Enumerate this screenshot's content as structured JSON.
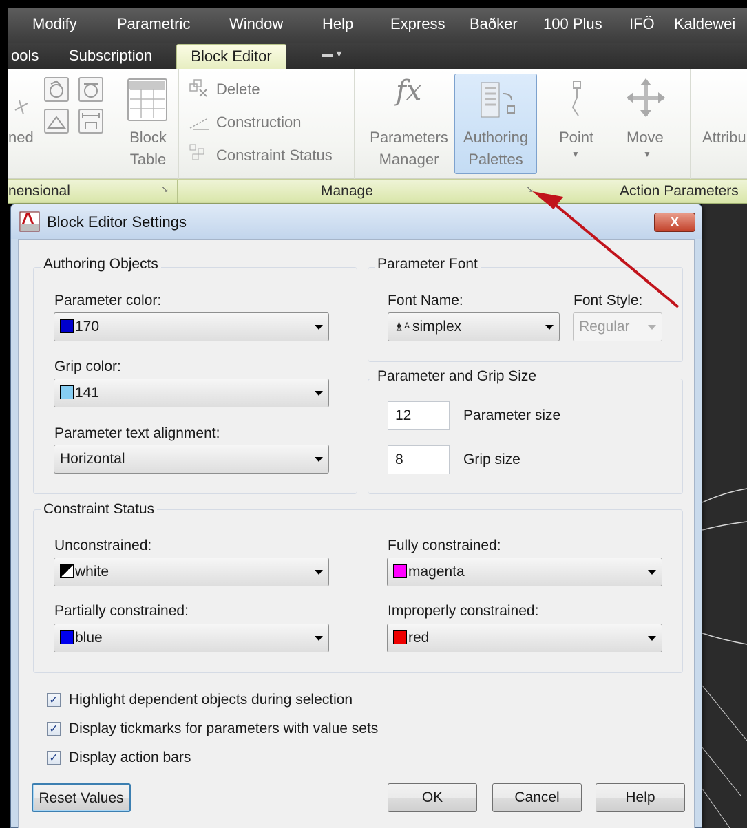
{
  "menubar": {
    "items": [
      "Modify",
      "Parametric",
      "Window",
      "Help",
      "Express",
      "Baðker",
      "100 Plus",
      "IFÖ",
      "Kaldewei"
    ]
  },
  "tabs": {
    "items": [
      "ools",
      "Subscription"
    ],
    "active": "Block Editor"
  },
  "ribbon": {
    "left_partial": "ned",
    "block_table": [
      "Block",
      "Table"
    ],
    "delete": "Delete",
    "construction": "Construction",
    "constraint_status": "Constraint Status",
    "parameters_manager": [
      "Parameters",
      "Manager"
    ],
    "authoring_palettes": [
      "Authoring",
      "Palettes"
    ],
    "point": "Point",
    "move": "Move",
    "attribute_partial": "Attribu",
    "panels": {
      "dimensional": "nensional",
      "manage": "Manage",
      "action_parameters": "Action Parameters"
    }
  },
  "dialog": {
    "title": "Block Editor Settings",
    "close_label": "X",
    "authoring": {
      "title": "Authoring Objects",
      "parameter_color_label": "Parameter color:",
      "parameter_color_value": "170",
      "parameter_color_swatch": "#0000cc",
      "grip_color_label": "Grip color:",
      "grip_color_value": "141",
      "grip_color_swatch": "#86cdf2",
      "text_alignment_label": "Parameter text alignment:",
      "text_alignment_value": "Horizontal"
    },
    "font": {
      "title": "Parameter Font",
      "font_name_label": "Font Name:",
      "font_name_value": "simplex",
      "font_style_label": "Font Style:",
      "font_style_value": "Regular"
    },
    "sizes": {
      "title": "Parameter and Grip Size",
      "parameter_size_value": "12",
      "parameter_size_label": "Parameter size",
      "grip_size_value": "8",
      "grip_size_label": "Grip size"
    },
    "constraint": {
      "title": "Constraint Status",
      "unconstrained_label": "Unconstrained:",
      "unconstrained_value": "white",
      "fully_label": "Fully constrained:",
      "fully_value": "magenta",
      "fully_swatch": "#ff00ff",
      "partially_label": "Partially constrained:",
      "partially_value": "blue",
      "partially_swatch": "#0000ee",
      "improperly_label": "Improperly constrained:",
      "improperly_value": "red",
      "improperly_swatch": "#ee0000"
    },
    "checkboxes": [
      {
        "label": "Highlight dependent objects during selection",
        "checked": true
      },
      {
        "label": "Display tickmarks for parameters with value sets",
        "checked": true
      },
      {
        "label": "Display action bars",
        "checked": true
      }
    ],
    "buttons": {
      "reset": "Reset Values",
      "ok": "OK",
      "cancel": "Cancel",
      "help": "Help"
    }
  },
  "colors": {
    "annotation_arrow": "#c1131b",
    "ribbon_active_tab": "#eef3cf",
    "dialog_frame": "#c9daec"
  }
}
